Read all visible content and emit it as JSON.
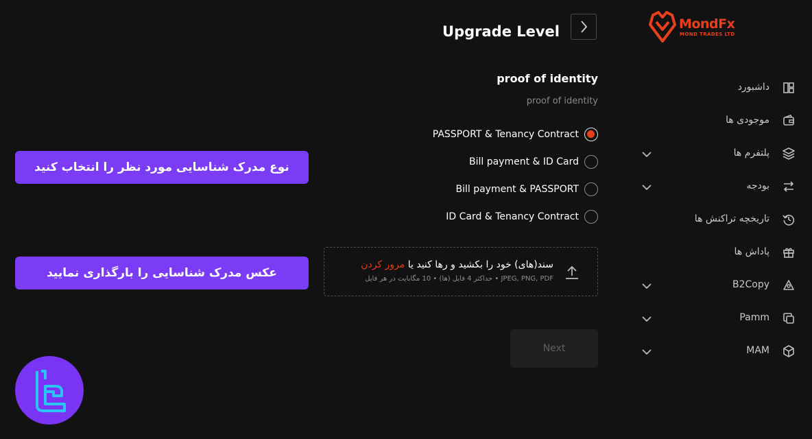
{
  "brand": {
    "name": "MondFx",
    "tagline": "MOND TRADES LTD",
    "color": "#e8401c"
  },
  "sidebar": {
    "items": [
      {
        "label": "داشبورد",
        "icon": "dashboard-icon",
        "expandable": false
      },
      {
        "label": "موجودی ها",
        "icon": "wallet-icon",
        "expandable": false
      },
      {
        "label": "پلتفرم ها",
        "icon": "layers-icon",
        "expandable": true
      },
      {
        "label": "بودجه",
        "icon": "transfer-icon",
        "expandable": true
      },
      {
        "label": "تاریخچه تراکنش ها",
        "icon": "history-icon",
        "expandable": false
      },
      {
        "label": "پاداش ها",
        "icon": "gift-icon",
        "expandable": false
      },
      {
        "label": "B2Copy",
        "icon": "copy-trade-icon",
        "expandable": true
      },
      {
        "label": "Pamm",
        "icon": "pamm-icon",
        "expandable": true
      },
      {
        "label": "MAM",
        "icon": "cube-icon",
        "expandable": true
      }
    ]
  },
  "header": {
    "title": "Upgrade Level",
    "back_icon": "chevron-right-icon"
  },
  "section": {
    "title": "proof of identity",
    "subtitle": "proof of identity"
  },
  "options": [
    {
      "label": "PASSPORT & Tenancy Contract",
      "selected": true
    },
    {
      "label": "Bill payment & ID Card",
      "selected": false
    },
    {
      "label": "Bill payment & PASSPORT",
      "selected": false
    },
    {
      "label": "ID Card & Tenancy Contract",
      "selected": false
    }
  ],
  "upload": {
    "text": "سند(های) خود را بکشید و رها کنید یا ",
    "link": "مرور کردن",
    "hint": "JPEG, PNG, PDF • حداکثر 4 فایل (ها) • 10 مگابایت در هر فایل",
    "icon": "upload-icon"
  },
  "next_label": "Next",
  "annotations": [
    "نوع مدرک شناسایی مورد نظر را انتخاب کنید",
    "عکس مدرک شناسایی را بارگذاری نمایید"
  ],
  "colors": {
    "accent": "#e8401c",
    "annotation": "#7b3cf5",
    "background": "#121212"
  }
}
